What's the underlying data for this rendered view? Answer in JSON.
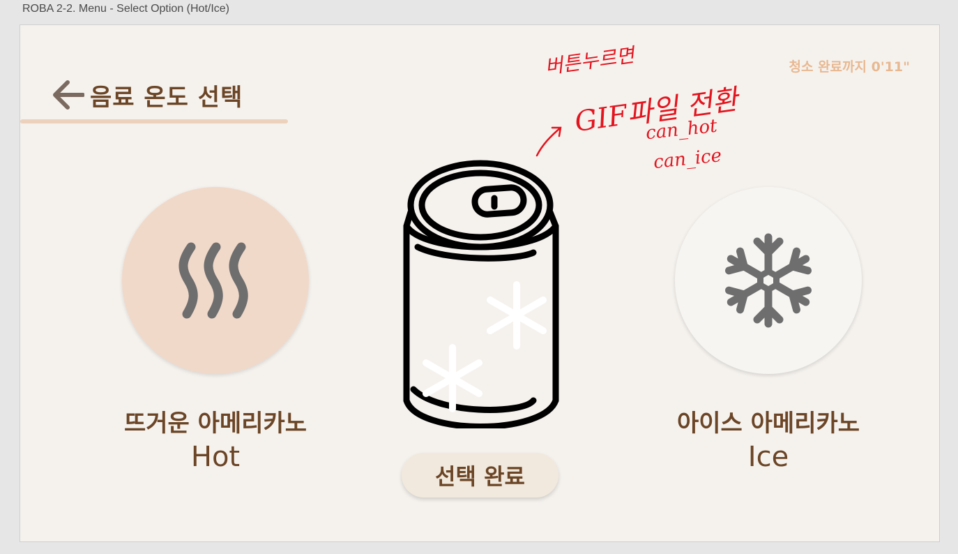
{
  "frame": {
    "title": "ROBA 2-2. Menu - Select Option (Hot/Ice)"
  },
  "header": {
    "back_icon": "arrow-left-icon",
    "title": "음료 온도 선택",
    "timer": "청소 완료까지 0'11\""
  },
  "options": {
    "hot": {
      "icon": "steam-icon",
      "label_ko": "뜨거운 아메리카노",
      "label_en": "Hot"
    },
    "ice": {
      "icon": "snowflake-icon",
      "label_ko": "아이스 아메리카노",
      "label_en": "Ice"
    }
  },
  "preview": {
    "icon": "can-icon"
  },
  "confirm": {
    "label": "선택 완료"
  },
  "annotation": {
    "line1": "버튼누르면",
    "line2": "GIF파일 전환",
    "line3": "can_hot",
    "line4": "can_ice"
  },
  "colors": {
    "brand_brown": "#6b4526",
    "hot_bg": "#f1d9ca",
    "accent_line": "#ecd2bd",
    "timer": "#e8b891",
    "icon_gray": "#6e6e6e",
    "annotation_red": "#e3141e"
  }
}
